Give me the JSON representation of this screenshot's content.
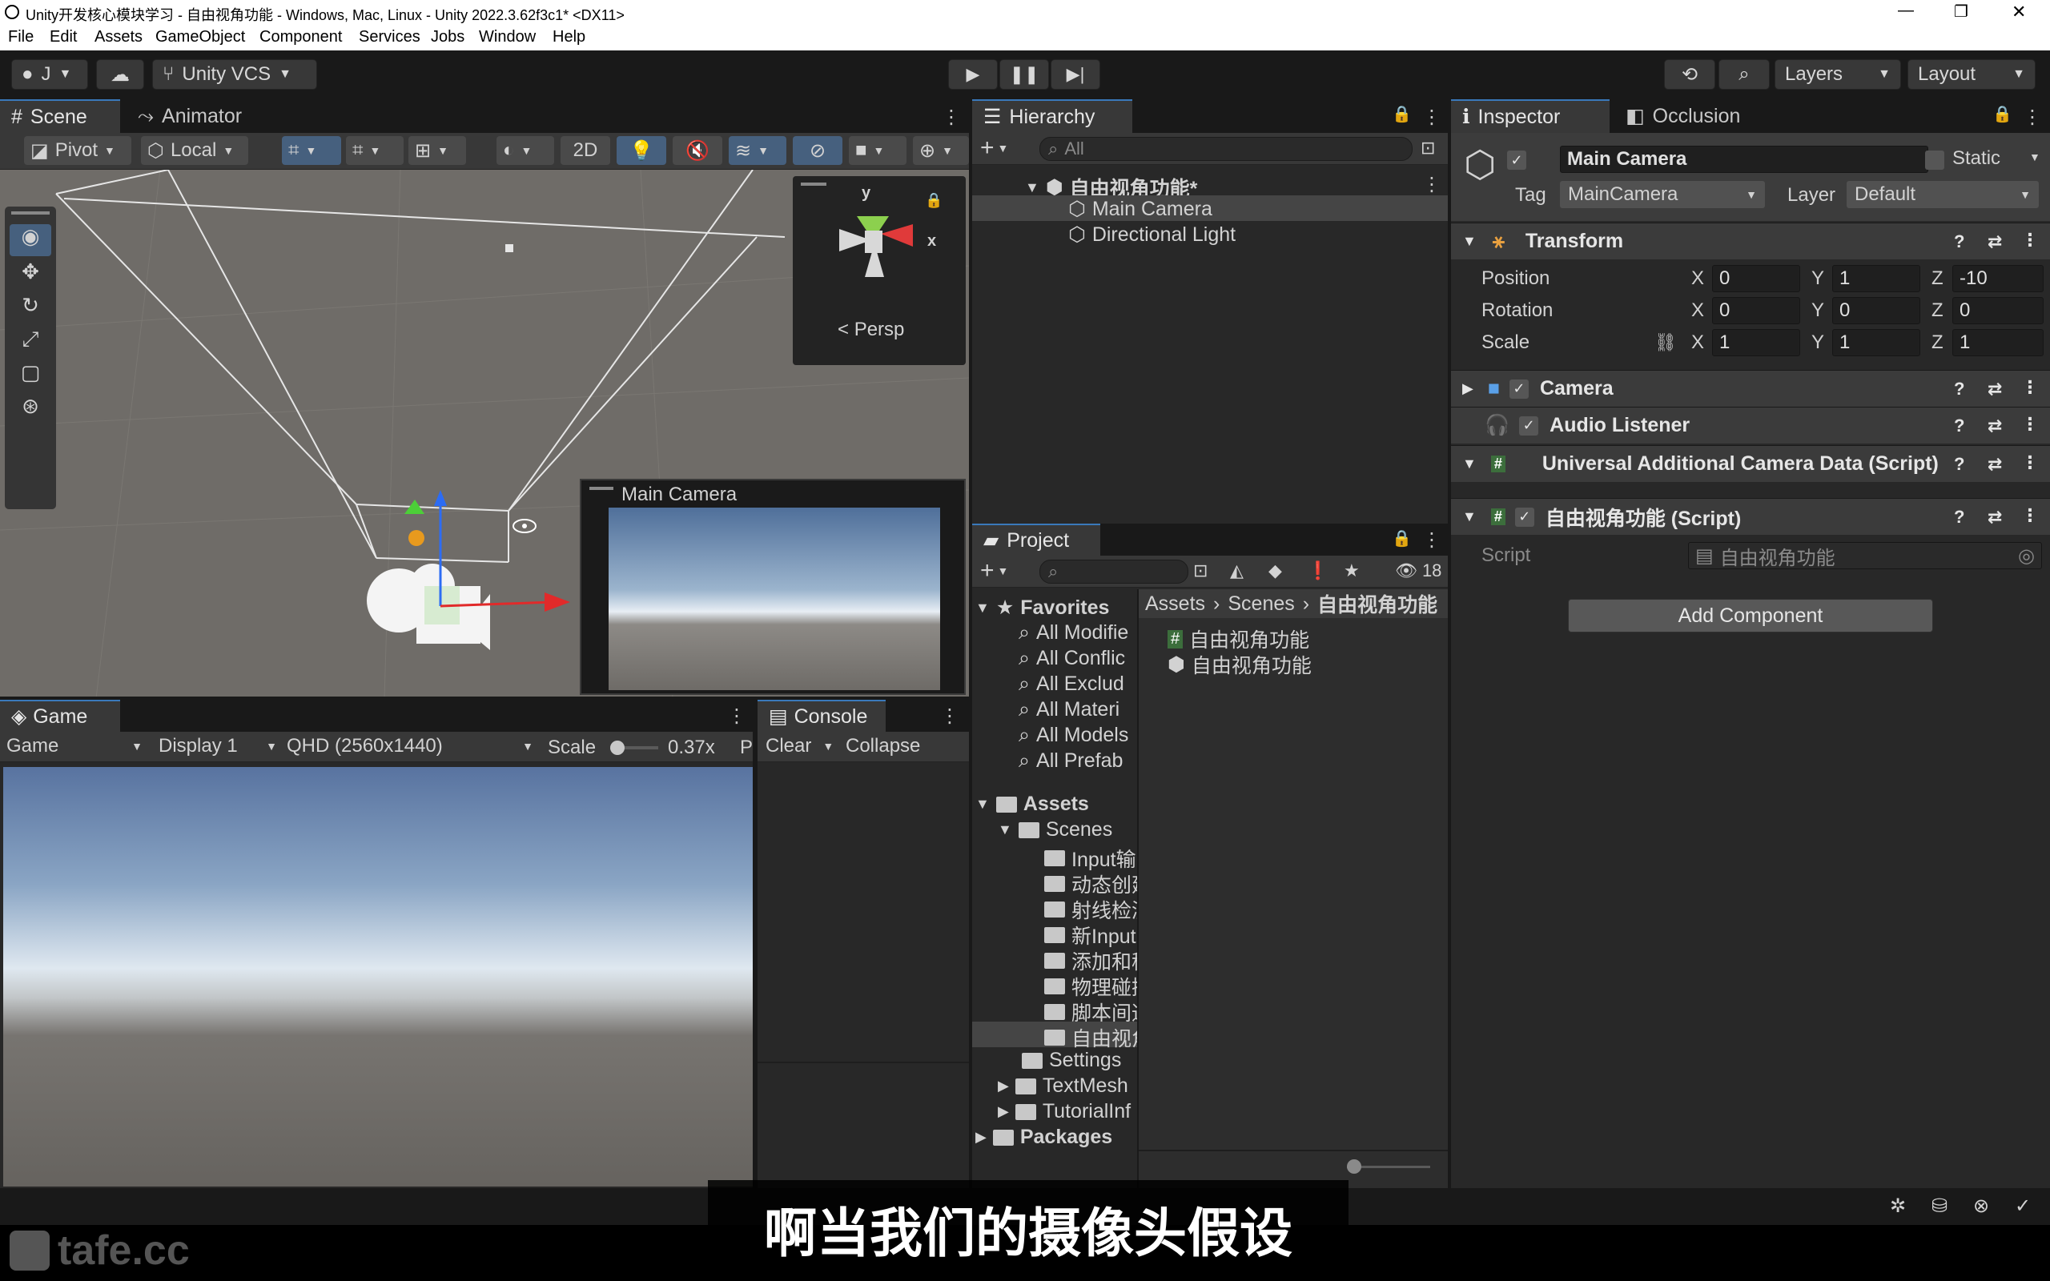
{
  "window": {
    "title": "Unity开发核心模块学习 - 自由视角功能 - Windows, Mac, Linux - Unity 2022.3.62f3c1* <DX11>",
    "minimize": "—",
    "maximize": "❐",
    "close": "✕"
  },
  "menu": [
    "File",
    "Edit",
    "Assets",
    "GameObject",
    "Component",
    "Services",
    "Jobs",
    "Window",
    "Help"
  ],
  "toolbar": {
    "account": "J",
    "vcs": "Unity VCS",
    "layers": "Layers",
    "layout": "Layout"
  },
  "scene": {
    "tab": "Scene",
    "tab2": "Animator",
    "pivot": "Pivot",
    "local": "Local",
    "mode2d": "2D",
    "persp": "Persp",
    "gizmo_y": "y",
    "gizmo_x": "x",
    "cam_preview_title": "Main Camera"
  },
  "game": {
    "tab": "Game",
    "mode": "Game",
    "display": "Display 1",
    "resolution": "QHD (2560x1440)",
    "scale_label": "Scale",
    "scale_value": "0.37x",
    "play_label": "Pl"
  },
  "console": {
    "tab": "Console",
    "clear": "Clear",
    "collapse": "Collapse"
  },
  "hierarchy": {
    "tab": "Hierarchy",
    "search_placeholder": "All",
    "scene": "自由视角功能*",
    "items": [
      "Main Camera",
      "Directional Light"
    ]
  },
  "project": {
    "tab": "Project",
    "count": "18",
    "favorites_label": "Favorites",
    "favorites": [
      "All Modifie",
      "All Conflic",
      "All Exclud",
      "All Materi",
      "All Models",
      "All Prefab"
    ],
    "assets_label": "Assets",
    "scenes_label": "Scenes",
    "scene_folders": [
      "Input输",
      "动态创建",
      "射线检测",
      "新Input",
      "添加和移",
      "物理碰撞",
      "脚本间通",
      "自由视角"
    ],
    "other_folders": [
      "Settings",
      "TextMesh",
      "TutorialInf"
    ],
    "packages_label": "Packages",
    "breadcrumb": [
      "Assets",
      "Scenes",
      "自由视角功能"
    ],
    "files": [
      "自由视角功能",
      "自由视角功能"
    ]
  },
  "inspector": {
    "tab": "Inspector",
    "tab2": "Occlusion",
    "object_name": "Main Camera",
    "static_label": "Static",
    "tag_label": "Tag",
    "tag_value": "MainCamera",
    "layer_label": "Layer",
    "layer_value": "Default",
    "transform_label": "Transform",
    "position_label": "Position",
    "position": {
      "x": "0",
      "y": "1",
      "z": "-10"
    },
    "rotation_label": "Rotation",
    "rotation": {
      "x": "0",
      "y": "0",
      "z": "0"
    },
    "scale_label": "Scale",
    "scale": {
      "x": "1",
      "y": "1",
      "z": "1"
    },
    "axis": {
      "x": "X",
      "y": "Y",
      "z": "Z"
    },
    "components": [
      "Camera",
      "Audio Listener",
      "Universal Additional Camera Data (Script)",
      "自由视角功能 (Script)"
    ],
    "script_label": "Script",
    "script_value": "自由视角功能",
    "add_component": "Add Component"
  },
  "subtitle": "啊当我们的摄像头假设",
  "watermark": "tafe.cc",
  "colors": {
    "accent": "#3a79bb",
    "panel": "#282828",
    "header": "#383838"
  }
}
